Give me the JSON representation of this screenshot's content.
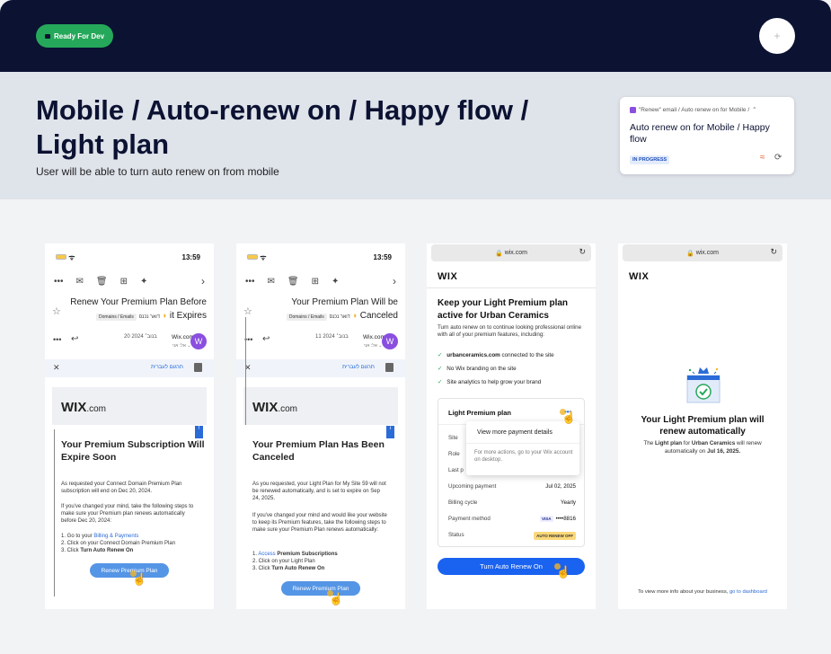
{
  "topbar": {
    "status_badge": "Ready For Dev"
  },
  "header": {
    "title": "Mobile / Auto-renew on / Happy flow / Light plan",
    "subtitle": "User will be able to turn auto renew on from mobile"
  },
  "ticket": {
    "crumb": "\"Renew\" email / Auto renew on for Mobile /",
    "title": "Auto renew on for Mobile / Happy flow",
    "status": "IN PROGRESS"
  },
  "phone": {
    "time": "13:59"
  },
  "email1": {
    "subject_a": "Renew Your Premium Plan Before",
    "subject_b": "it Expires",
    "tag": "Domains / Emails",
    "heb_tag": "דואר נכנס",
    "date": "20 בנוב׳ 2024",
    "from": "Wix.com",
    "to": "אל: אני ⌄",
    "avatar": "W",
    "translate": "תרגום לעברית",
    "logo": "WIX",
    "logo_suffix": ".com",
    "heading": "Your Premium Subscription Will Expire Soon",
    "p1": "As requested your Connect Domain Premium Plan subscription will end on Dec 20, 2024.",
    "p2": "If you've changed your mind, take the following steps to make sure your Premium plan renews automatically before Dec 20, 2024:",
    "step1a": "1. Go to your ",
    "step1b": "Billing & Payments",
    "step2": "2. Click on your Connect Domain Premium Plan",
    "step3a": "3. Click ",
    "step3b": "Turn Auto Renew On",
    "cta": "Renew Premium Plan"
  },
  "email2": {
    "subject_a": "Your Premium Plan Will be",
    "subject_b": "Canceled",
    "tag": "Domains / Emails",
    "heb_tag": "דואר נכנס",
    "date": "11 בנוב׳ 2024",
    "from": "Wix.com",
    "to": "אל: אני ⌄",
    "avatar": "W",
    "translate": "תרגום לעברית",
    "logo": "WIX",
    "logo_suffix": ".com",
    "heading": "Your Premium Plan Has Been Canceled",
    "p1": "As you requested, your Light Plan for My Site 59 will not be renewed automatically, and is set to expire on Sep 24, 2025.",
    "p2": "If you've changed your mind and would like your website to keep its Premium features, take the following steps to make sure your Premium Plan renews automatically:",
    "step1a": "1. ",
    "step1link": "Access",
    "step1b": " Premium Subscriptions",
    "step2": "2. Click on your Light Plan",
    "step3a": "3. Click ",
    "step3b": "Turn Auto Renew On",
    "cta": "Renew Premium Plan"
  },
  "web": {
    "url": "wix.com",
    "logo": "WIX",
    "heading": "Keep your Light Premium plan active for Urban Ceramics",
    "intro": "Turn auto renew on to continue looking professional online with all of your premium features, including:",
    "checks": [
      {
        "bold": "urbanceramics.com",
        "rest": " connected to the site"
      },
      {
        "bold": "",
        "rest": "No Wix branding on the site"
      },
      {
        "bold": "",
        "rest": "Site analytics to help grow your brand"
      }
    ],
    "plan_title": "Light Premium plan",
    "more": "•••",
    "rows": [
      {
        "k": "Site",
        "v": ""
      },
      {
        "k": "Role",
        "v": ""
      },
      {
        "k": "Last p",
        "v": ""
      },
      {
        "k": "Upcoming payment",
        "v": "Jul 02, 2025"
      },
      {
        "k": "Billing cycle",
        "v": "Yearly"
      },
      {
        "k": "Payment method",
        "v": "••••8816"
      },
      {
        "k": "Status",
        "v": "AUTO RENEW OFF"
      }
    ],
    "visa": "VISA",
    "popover_item": "View more payment details",
    "popover_note": "For more actions, go to your Wix account on desktop.",
    "cta": "Turn Auto Renew On"
  },
  "success": {
    "url": "wix.com",
    "logo": "WIX",
    "heading": "Your Light Premium plan will renew automatically",
    "p_a": "The ",
    "p_b": "Light plan",
    "p_c": " for ",
    "p_d": "Urban Ceramics",
    "p_e": " will renew automatically on ",
    "p_f": "Jul 16, 2025.",
    "foot_a": "To view more info about your business, ",
    "foot_link": "go to dashboard"
  }
}
